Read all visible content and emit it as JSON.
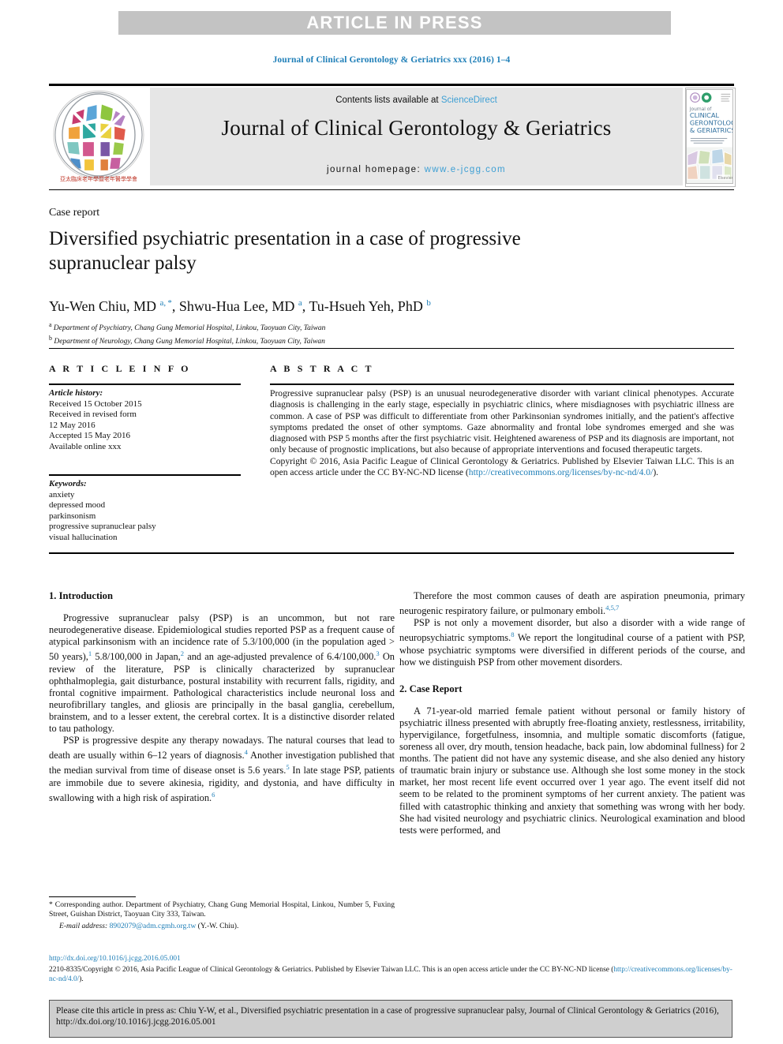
{
  "banner": {
    "label": "ARTICLE IN PRESS"
  },
  "running_head": "Journal of Clinical Gerontology & Geriatrics xxx (2016) 1–4",
  "masthead": {
    "contents_prefix": "Contents lists available at ",
    "sciencedirect": "ScienceDirect",
    "journal_title": "Journal of Clinical Gerontology & Geriatrics",
    "homepage_label": "journal homepage: ",
    "homepage_url": "www.e-jcgg.com",
    "logo_alt": "apl-cgg-tree-logo",
    "cover_alt": "journal-cover-thumbnail",
    "cover_title_lines": [
      "Journal of",
      "CLINICAL",
      "GERONTOLOGY",
      "& GERIATRICS"
    ]
  },
  "article": {
    "section_type": "Case report",
    "title": "Diversified psychiatric presentation in a case of progressive supranuclear palsy",
    "authors_html": "Yu-Wen Chiu, MD <sup>a, *</sup>, Shwu-Hua Lee, MD <sup>a</sup>, Tu-Hsueh Yeh, PhD <sup>b</sup>",
    "affiliations": [
      {
        "mark": "a",
        "text": "Department of Psychiatry, Chang Gung Memorial Hospital, Linkou, Taoyuan City, Taiwan"
      },
      {
        "mark": "b",
        "text": "Department of Neurology, Chang Gung Memorial Hospital, Linkou, Taoyuan City, Taiwan"
      }
    ]
  },
  "info": {
    "heading": "A R T I C L E   I N F O",
    "history_label": "Article history:",
    "history": [
      "Received 15 October 2015",
      "Received in revised form",
      "12 May 2016",
      "Accepted 15 May 2016",
      "Available online xxx"
    ],
    "keywords_label": "Keywords:",
    "keywords": [
      "anxiety",
      "depressed mood",
      "parkinsonism",
      "progressive supranuclear palsy",
      "visual hallucination"
    ]
  },
  "abstract": {
    "heading": "A B S T R A C T",
    "body": "Progressive supranuclear palsy (PSP) is an unusual neurodegenerative disorder with variant clinical phenotypes. Accurate diagnosis is challenging in the early stage, especially in psychiatric clinics, where misdiagnoses with psychiatric illness are common. A case of PSP was difficult to differentiate from other Parkinsonian syndromes initially, and the patient's affective symptoms predated the onset of other symptoms. Gaze abnormality and frontal lobe syndromes emerged and she was diagnosed with PSP 5 months after the first psychiatric visit. Heightened awareness of PSP and its diagnosis are important, not only because of prognostic implications, but also because of appropriate interventions and focused therapeutic targets.",
    "copyright_text": "Copyright © 2016, Asia Pacific League of Clinical Gerontology & Geriatrics. Published by Elsevier Taiwan LLC. This is an open access article under the CC BY-NC-ND license (",
    "copyright_link": "http://creativecommons.org/licenses/by-nc-nd/4.0/",
    "copyright_tail": ")."
  },
  "body": {
    "intro_heading": "1. Introduction",
    "case_heading": "2. Case Report",
    "left_p1": "Progressive supranuclear palsy (PSP) is an uncommon, but not rare neurodegenerative disease. Epidemiological studies reported PSP as a frequent cause of atypical parkinsonism with an incidence rate of 5.3/100,000 (in the population aged > 50 years),<sup>1</sup> 5.8/100,000 in Japan,<sup>2</sup> and an age-adjusted prevalence of 6.4/100,000.<sup>3</sup> On review of the literature, PSP is clinically characterized by supranuclear ophthalmoplegia, gait disturbance, postural instability with recurrent falls, rigidity, and frontal cognitive impairment. Pathological characteristics include neuronal loss and neurofibrillary tangles, and gliosis are principally in the basal ganglia, cerebellum, brainstem, and to a lesser extent, the cerebral cortex. It is a distinctive disorder related to tau pathology.",
    "left_p2": "PSP is progressive despite any therapy nowadays. The natural courses that lead to death are usually within 6–12 years of diagnosis.<sup>4</sup> Another investigation published that the median survival from time of disease onset is 5.6 years.<sup>5</sup> In late stage PSP, patients are immobile due to severe akinesia, rigidity, and dystonia, and have difficulty in swallowing with a high risk of aspiration.<sup>6</sup>",
    "right_p1": "Therefore the most common causes of death are aspiration pneumonia, primary neurogenic respiratory failure, or pulmonary emboli.<sup>4,5,7</sup>",
    "right_p2": "PSP is not only a movement disorder, but also a disorder with a wide range of neuropsychiatric symptoms.<sup>8</sup> We report the longitudinal course of a patient with PSP, whose psychiatric symptoms were diversified in different periods of the course, and how we distinguish PSP from other movement disorders.",
    "right_p3": "A 71-year-old married female patient without personal or family history of psychiatric illness presented with abruptly free-floating anxiety, restlessness, irritability, hypervigilance, forgetfulness, insomnia, and multiple somatic discomforts (fatigue, soreness all over, dry mouth, tension headache, back pain, low abdominal fullness) for 2 months. The patient did not have any systemic disease, and she also denied any history of traumatic brain injury or substance use. Although she lost some money in the stock market, her most recent life event occurred over 1 year ago. The event itself did not seem to be related to the prominent symptoms of her current anxiety. The patient was filled with catastrophic thinking and anxiety that something was wrong with her body. She had visited neurology and psychiatric clinics. Neurological examination and blood tests were performed, and"
  },
  "footnote": {
    "corresponding": "* Corresponding author. Department of Psychiatry, Chang Gung Memorial Hospital, Linkou, Number 5, Fuxing Street, Guishan District, Taoyuan City 333, Taiwan.",
    "email_label": "E-mail address:",
    "email": "8902079@adm.cgmh.org.tw",
    "email_owner": "(Y.-W. Chiu)."
  },
  "bottom": {
    "doi": "http://dx.doi.org/10.1016/j.jcgg.2016.05.001",
    "issn_copyright": "2210-8335/Copyright © 2016, Asia Pacific League of Clinical Gerontology & Geriatrics. Published by Elsevier Taiwan LLC. This is an open access article under the CC BY-NC-ND license (",
    "license_link": "http://creativecommons.org/licenses/by-nc-nd/4.0/",
    "license_tail": ")."
  },
  "cite_box": {
    "text": "Please cite this article in press as: Chiu Y-W, et al., Diversified psychiatric presentation in a case of progressive supranuclear palsy, Journal of Clinical Gerontology & Geriatrics (2016), http://dx.doi.org/10.1016/j.jcgg.2016.05.001"
  },
  "colors": {
    "link": "#1f7fb8",
    "sciencedirect": "#3d9fd4",
    "banner_bg": "#c3c3c3",
    "masthead_bg": "#e6e6e6",
    "citebox_bg": "#cfcfcf"
  }
}
